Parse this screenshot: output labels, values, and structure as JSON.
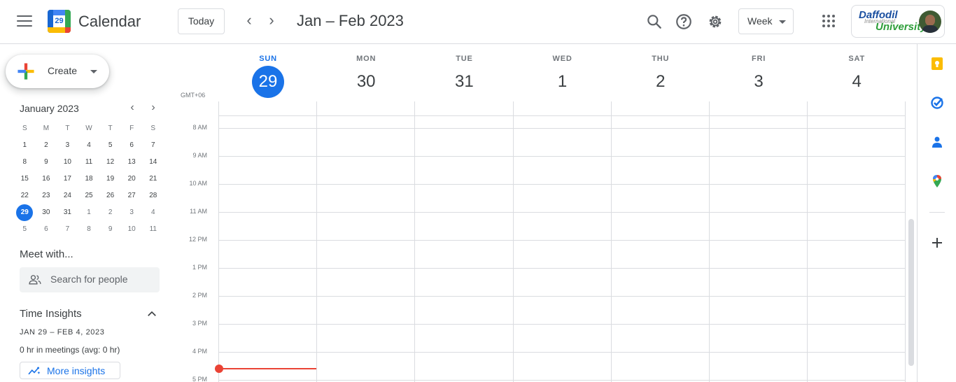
{
  "header": {
    "app_title": "Calendar",
    "logo_day": "29",
    "today_label": "Today",
    "prev_arrow": "‹",
    "next_arrow": "›",
    "range_title": "Jan – Feb 2023",
    "view_select": "Week",
    "icons": [
      "main-menu-icon",
      "search-icon",
      "help-icon",
      "settings-icon",
      "google-apps-icon"
    ],
    "account": {
      "org_line1": "Daffodil",
      "org_line2": "University",
      "org_line3": "International"
    }
  },
  "create": {
    "label": "Create"
  },
  "mini_calendar": {
    "title": "January 2023",
    "prev": "‹",
    "next": "›",
    "weekdays": [
      "S",
      "M",
      "T",
      "W",
      "T",
      "F",
      "S"
    ],
    "weeks": [
      [
        "1",
        "2",
        "3",
        "4",
        "5",
        "6",
        "7"
      ],
      [
        "8",
        "9",
        "10",
        "11",
        "12",
        "13",
        "14"
      ],
      [
        "15",
        "16",
        "17",
        "18",
        "19",
        "20",
        "21"
      ],
      [
        "22",
        "23",
        "24",
        "25",
        "26",
        "27",
        "28"
      ],
      [
        "29",
        "30",
        "31",
        "1",
        "2",
        "3",
        "4"
      ],
      [
        "5",
        "6",
        "7",
        "8",
        "9",
        "10",
        "11"
      ]
    ],
    "today": "29"
  },
  "meet_with": {
    "title": "Meet with...",
    "search_placeholder": "Search for people"
  },
  "time_insights": {
    "title": "Time Insights",
    "range": "JAN 29 – FEB 4, 2023",
    "meetings": "0 hr in meetings (avg: 0 hr)",
    "more_label": "More insights"
  },
  "week_view": {
    "timezone": "GMT+06",
    "days": [
      {
        "dow": "SUN",
        "num": "29",
        "today": true
      },
      {
        "dow": "MON",
        "num": "30",
        "today": false
      },
      {
        "dow": "TUE",
        "num": "31",
        "today": false
      },
      {
        "dow": "WED",
        "num": "1",
        "today": false
      },
      {
        "dow": "THU",
        "num": "2",
        "today": false
      },
      {
        "dow": "FRI",
        "num": "3",
        "today": false
      },
      {
        "dow": "SAT",
        "num": "4",
        "today": false
      }
    ],
    "hours": [
      "8 AM",
      "9 AM",
      "10 AM",
      "11 AM",
      "12 PM",
      "1 PM",
      "2 PM",
      "3 PM",
      "4 PM",
      "5 PM"
    ]
  },
  "side_panel": {
    "icons": [
      "keep-icon",
      "tasks-icon",
      "contacts-icon",
      "maps-icon",
      "get-addons-icon"
    ],
    "colors": {
      "keep": "#fbbc04",
      "tasks": "#1a73e8",
      "contacts": "#1a73e8"
    }
  },
  "colors": {
    "accent": "#1a73e8",
    "now_line": "#ea4335",
    "border": "#dadce0"
  }
}
